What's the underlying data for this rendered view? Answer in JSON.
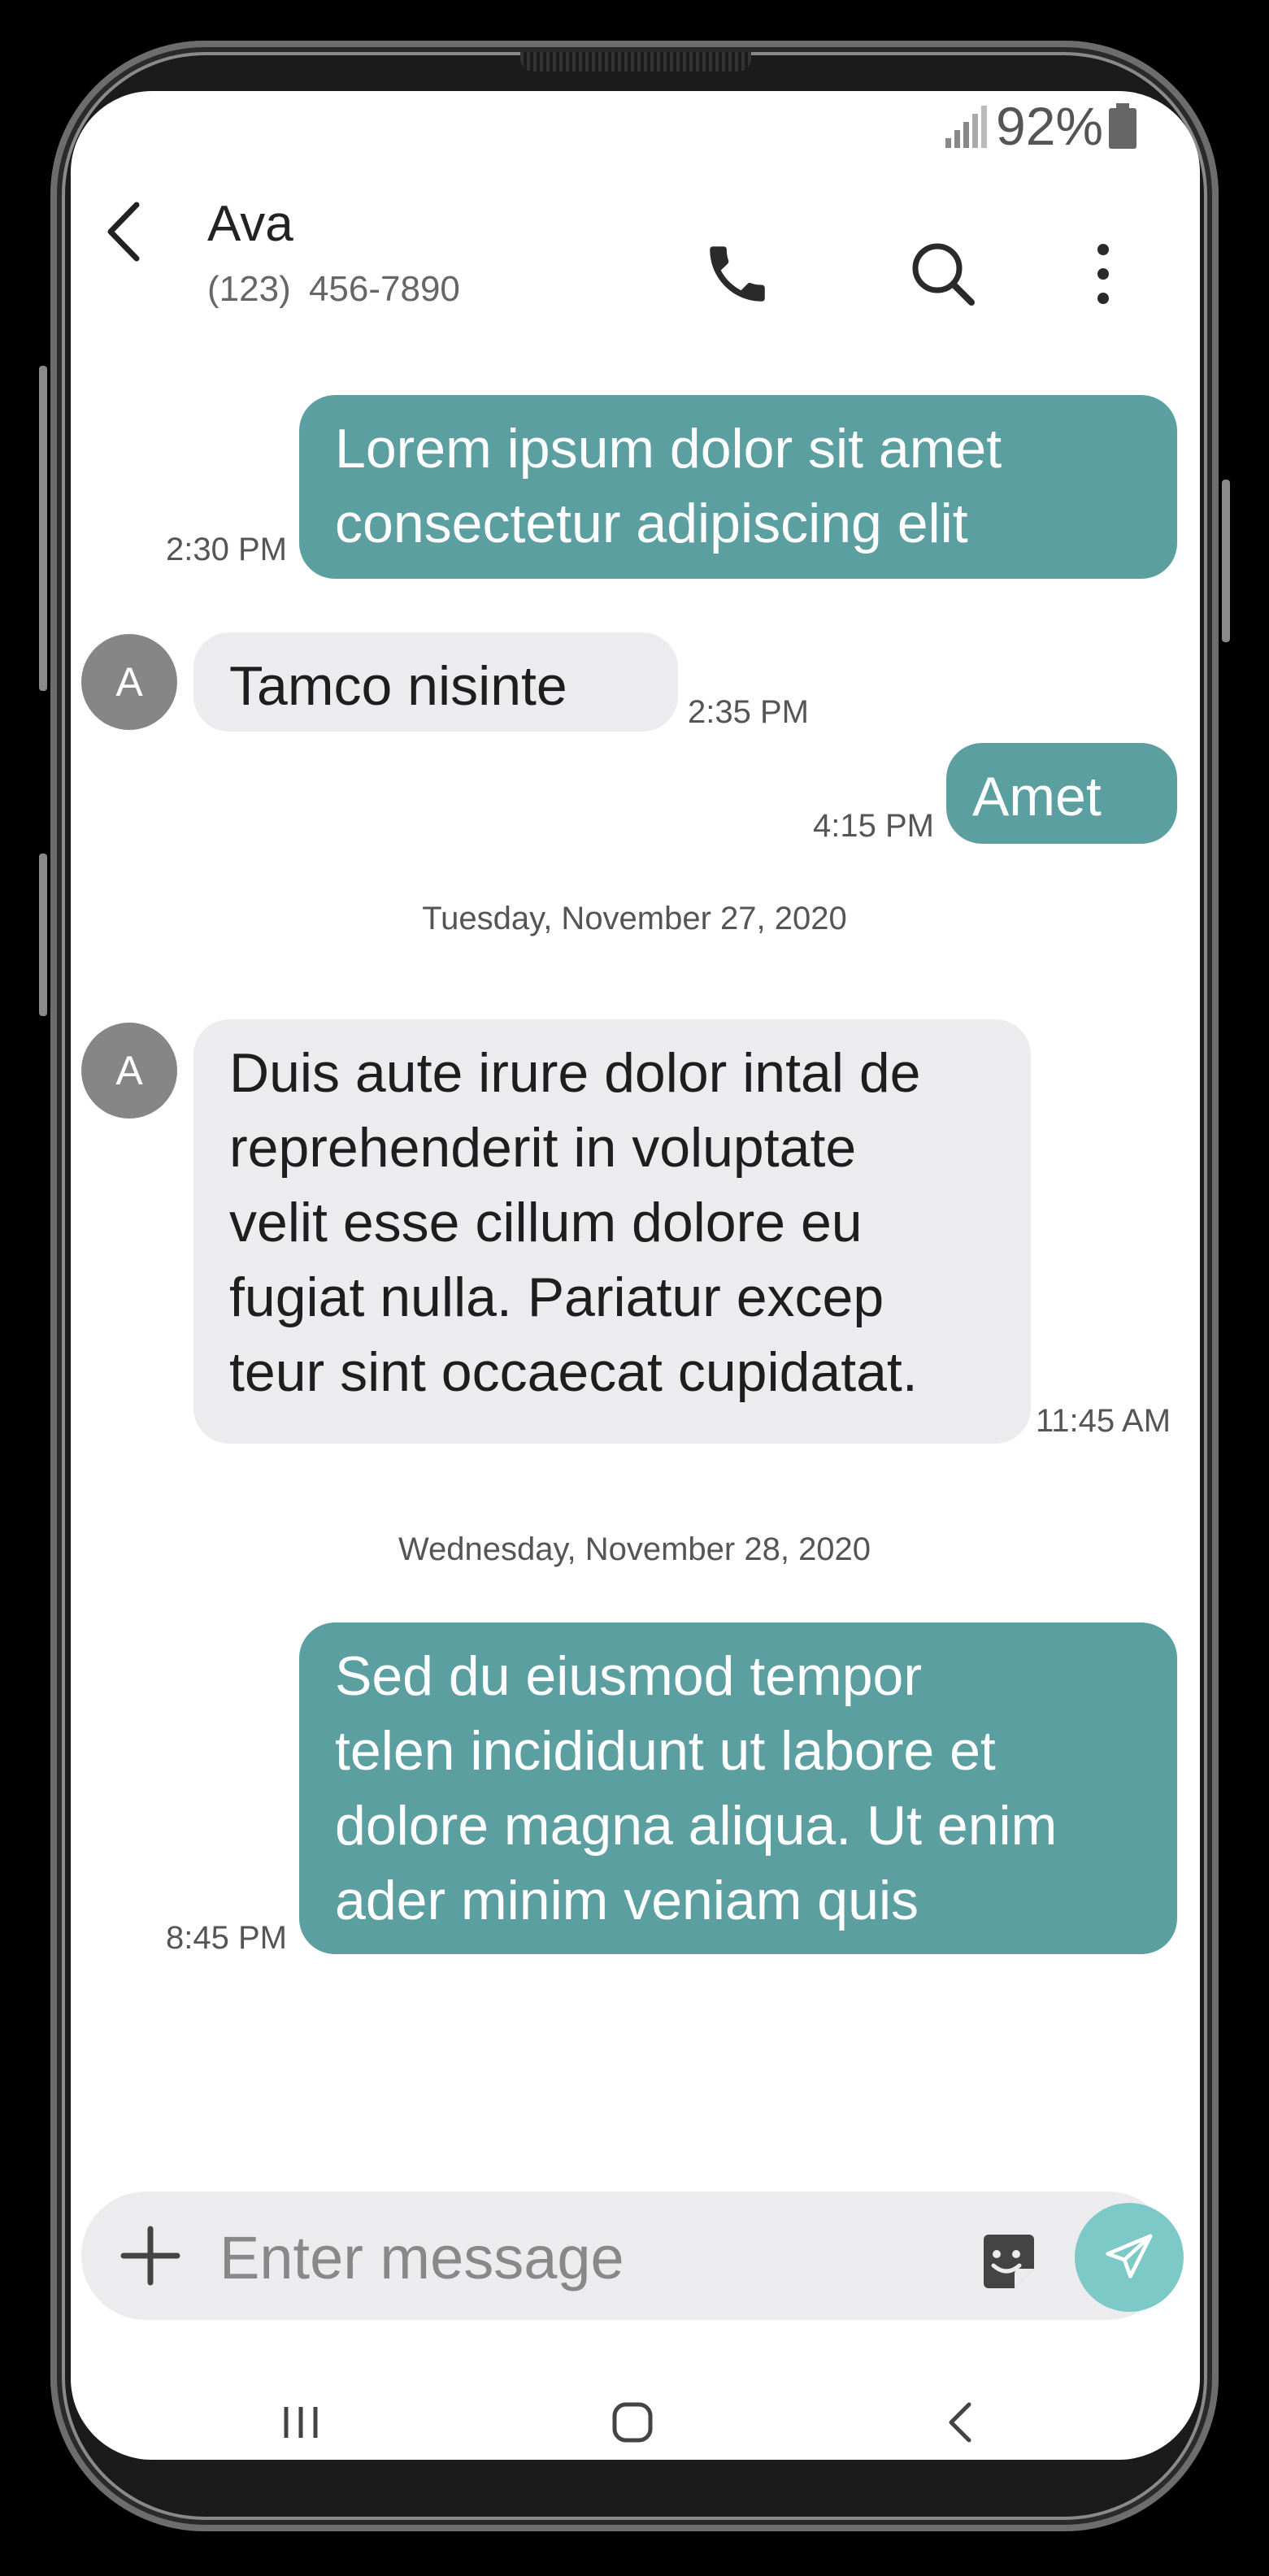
{
  "status_bar": {
    "battery_percent": "92%",
    "signal_icon": "signal-bars-icon",
    "battery_icon": "battery-icon"
  },
  "header": {
    "contact_name": "Ava",
    "contact_number": "(123)  456-7890",
    "icons": [
      "back-arrow-icon",
      "phone-icon",
      "search-icon",
      "more-vertical-icon"
    ]
  },
  "conversation": {
    "messages": [
      {
        "direction": "outgoing",
        "text_lines": [
          "Lorem ipsum dolor sit amet",
          "consectetur adipiscing elit"
        ],
        "time": "2:30 PM"
      },
      {
        "direction": "incoming",
        "avatar": "A",
        "text_lines": [
          "Tamco nisinte"
        ],
        "time": "2:35 PM"
      },
      {
        "direction": "outgoing",
        "text_lines": [
          "Amet"
        ],
        "time": "4:15 PM"
      },
      {
        "direction": "incoming",
        "avatar": "A",
        "text_lines": [
          "Duis aute irure dolor intal de",
          "reprehenderit in voluptate",
          "velit esse cillum dolore eu",
          "fugiat nulla. Pariatur excep",
          "teur sint occaecat cupidatat."
        ],
        "time": "11:45 AM"
      },
      {
        "direction": "outgoing",
        "text_lines": [
          "Sed du eiusmod tempor",
          "telen incididunt ut labore et",
          "dolore magna aliqua. Ut enim",
          "ader minim veniam quis"
        ],
        "time": "8:45 PM"
      }
    ],
    "date_dividers": [
      "Tuesday, November 27, 2020",
      "Wednesday, November 28, 2020"
    ]
  },
  "composer": {
    "placeholder": "Enter message",
    "icons": [
      "plus-icon",
      "sticker-icon",
      "send-icon"
    ]
  },
  "nav_bar": {
    "icons": [
      "recent-apps-icon",
      "home-icon",
      "nav-back-icon"
    ]
  },
  "colors": {
    "outgoing_bubble": "#5c9fa1",
    "incoming_bubble": "#ececee",
    "avatar": "#868686",
    "send_button": "#7cc9c7"
  }
}
